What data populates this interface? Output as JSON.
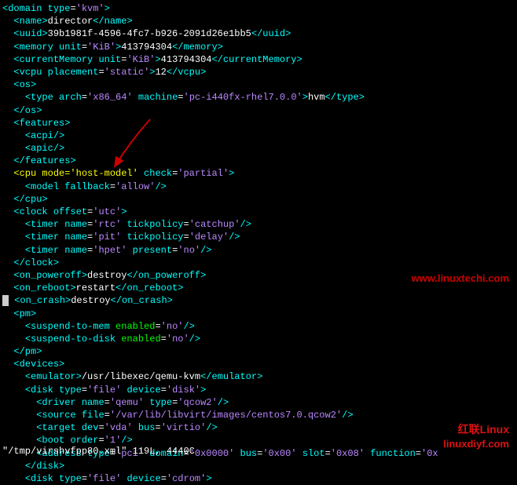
{
  "xml": {
    "domain_type": "kvm",
    "name": "director",
    "uuid": "39b1981f-4596-4fc7-b926-2091d26e1bb5",
    "memory_unit": "KiB",
    "memory": "413794304",
    "currentMemory_unit": "KiB",
    "currentMemory": "413794304",
    "vcpu_placement": "static",
    "vcpu": "12",
    "os_type_arch": "x86_64",
    "os_type_machine": "pc-i440fx-rhel7.0.0",
    "os_type": "hvm",
    "cpu_mode": "host-model",
    "cpu_check": "partial",
    "model_fallback": "allow",
    "clock_offset": "utc",
    "timer1_name": "rtc",
    "timer1_tickpolicy": "catchup",
    "timer2_name": "pit",
    "timer2_tickpolicy": "delay",
    "timer3_name": "hpet",
    "timer3_present": "no",
    "on_poweroff": "destroy",
    "on_reboot": "restart",
    "on_crash": "destroy",
    "suspend_mem": "no",
    "suspend_disk": "no",
    "emulator": "/usr/libexec/qemu-kvm",
    "disk1_type": "file",
    "disk1_device": "disk",
    "driver_name": "qemu",
    "driver_type": "qcow2",
    "source_file": "/var/lib/libvirt/images/centos7.0.qcow2",
    "target_dev": "vda",
    "target_bus": "virtio",
    "boot_order": "1",
    "addr_type": "pci",
    "addr_domain": "0x0000",
    "addr_bus": "0x00",
    "addr_slot": "0x08",
    "addr_function": "0x",
    "disk2_type": "file",
    "disk2_device": "cdrom"
  },
  "status": "\"/tmp/virshvfpp80.xml\" 119L, 4440C",
  "watermarks": {
    "w1": "www.linuxtechi.com",
    "w2": "红联Linux",
    "w3": "linuxdiyf.com"
  }
}
